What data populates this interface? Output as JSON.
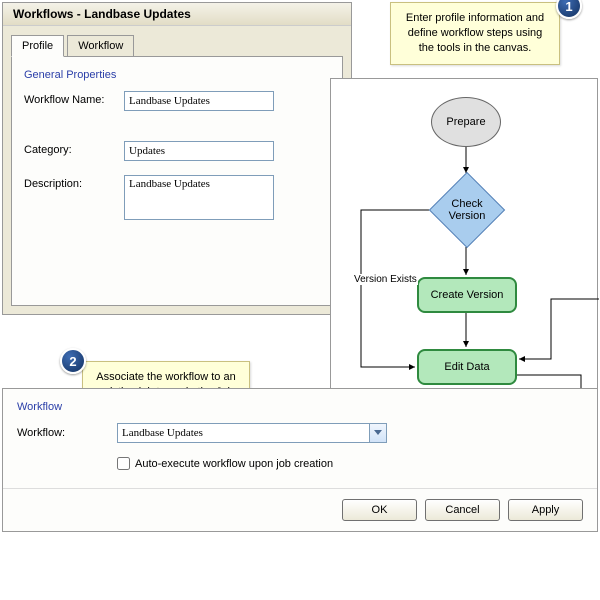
{
  "window": {
    "title": "Workflows - Landbase Updates"
  },
  "tabs": {
    "profile": "Profile",
    "workflow": "Workflow"
  },
  "profile_panel": {
    "legend": "General Properties",
    "name_label": "Workflow Name:",
    "name_value": "Landbase Updates",
    "category_label": "Category:",
    "category_value": "Updates",
    "description_label": "Description:",
    "description_value": "Landbase Updates"
  },
  "canvas": {
    "prepare": "Prepare",
    "check_version": "Check\nVersion",
    "create_version": "Create Version",
    "edit_data": "Edit Data",
    "edge_version_exists": "Version Exists"
  },
  "callouts": {
    "c1": "Enter profile information and define workflow steps using the tools in the canvas.",
    "c2": "Associate the workflow to an existing job type via the Job Type dialog.",
    "n1": "1",
    "n2": "2"
  },
  "workflow_panel": {
    "legend": "Workflow",
    "workflow_label": "Workflow:",
    "workflow_value": "Landbase Updates",
    "auto_execute_label": "Auto-execute workflow upon job creation"
  },
  "buttons": {
    "ok": "OK",
    "cancel": "Cancel",
    "apply": "Apply"
  }
}
